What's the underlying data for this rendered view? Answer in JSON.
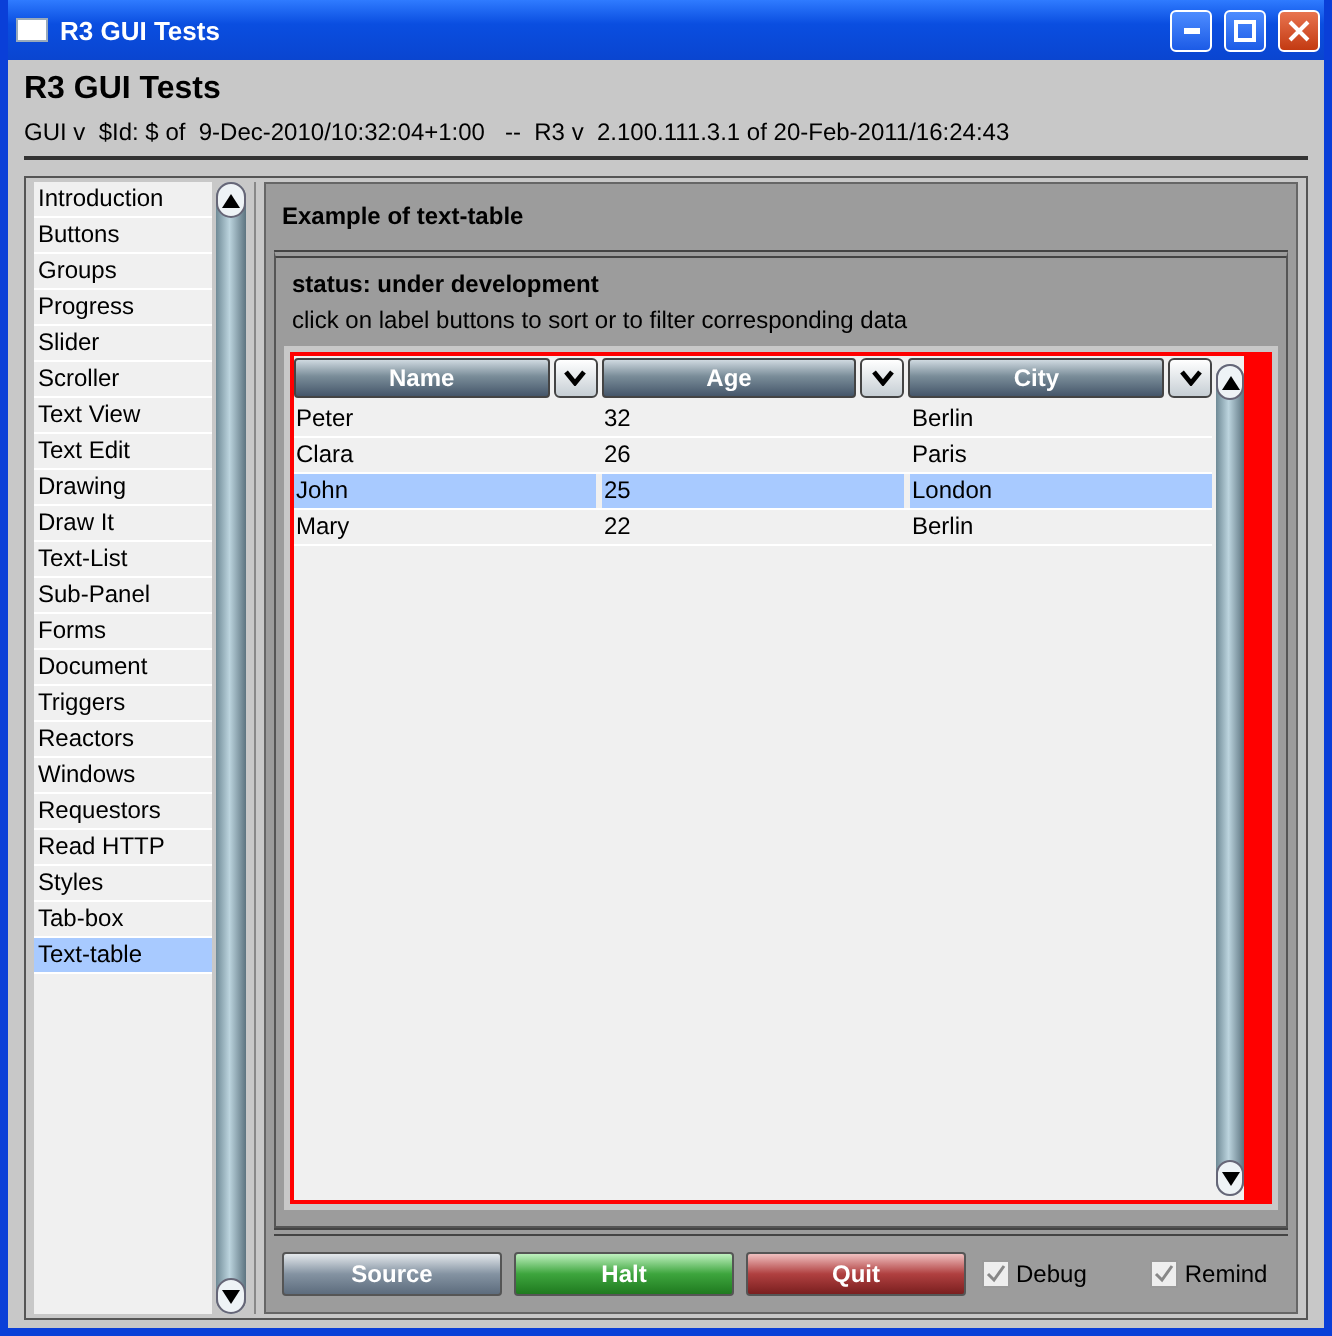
{
  "window": {
    "title": "R3 GUI Tests"
  },
  "header": {
    "title": "R3 GUI Tests",
    "subtitle": "GUI v  $Id: $ of  9-Dec-2010/10:32:04+1:00   --  R3 v  2.100.111.3.1 of 20-Feb-2011/16:24:43"
  },
  "sidebar": {
    "items": [
      {
        "label": "Introduction",
        "selected": false
      },
      {
        "label": "Buttons",
        "selected": false
      },
      {
        "label": "Groups",
        "selected": false
      },
      {
        "label": "Progress",
        "selected": false
      },
      {
        "label": "Slider",
        "selected": false
      },
      {
        "label": "Scroller",
        "selected": false
      },
      {
        "label": "Text View",
        "selected": false
      },
      {
        "label": "Text Edit",
        "selected": false
      },
      {
        "label": "Drawing",
        "selected": false
      },
      {
        "label": "Draw It",
        "selected": false
      },
      {
        "label": "Text-List",
        "selected": false
      },
      {
        "label": "Sub-Panel",
        "selected": false
      },
      {
        "label": "Forms",
        "selected": false
      },
      {
        "label": "Document",
        "selected": false
      },
      {
        "label": "Triggers",
        "selected": false
      },
      {
        "label": "Reactors",
        "selected": false
      },
      {
        "label": "Windows",
        "selected": false
      },
      {
        "label": "Requestors",
        "selected": false
      },
      {
        "label": "Read HTTP",
        "selected": false
      },
      {
        "label": "Styles",
        "selected": false
      },
      {
        "label": "Tab-box",
        "selected": false
      },
      {
        "label": "Text-table",
        "selected": true
      }
    ]
  },
  "panel": {
    "title": "Example of text-table",
    "status": "status: under development",
    "hint": "click on label buttons to sort or to filter corresponding data",
    "table": {
      "columns": [
        "Name",
        "Age",
        "City"
      ],
      "rows": [
        {
          "cells": [
            "Peter",
            "32",
            "Berlin"
          ],
          "selected": false
        },
        {
          "cells": [
            "Clara",
            "26",
            "Paris"
          ],
          "selected": false
        },
        {
          "cells": [
            "John",
            "25",
            "London"
          ],
          "selected": true
        },
        {
          "cells": [
            "Mary",
            "22",
            "Berlin"
          ],
          "selected": false
        }
      ]
    }
  },
  "buttons": [
    {
      "label": "Source",
      "kind": "neutral"
    },
    {
      "label": "Halt",
      "kind": "go"
    },
    {
      "label": "Quit",
      "kind": "stop"
    }
  ],
  "checkboxes": [
    {
      "label": "Debug",
      "checked": true
    },
    {
      "label": "Remind",
      "checked": true
    }
  ]
}
